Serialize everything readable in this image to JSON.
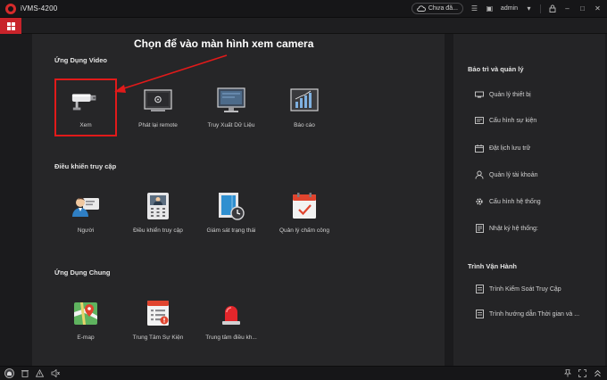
{
  "window": {
    "title": "iVMS-4200"
  },
  "titlebar": {
    "cloud_label": "Chưa đă...",
    "user": "admin"
  },
  "annotation": {
    "text": "Chọn để vào màn hình xem camera"
  },
  "sections": {
    "video": {
      "title": "Ứng Dụng Video",
      "tiles": [
        {
          "label": "Xem",
          "icon": "camera-icon"
        },
        {
          "label": "Phát lại remote",
          "icon": "playback-icon"
        },
        {
          "label": "Truy Xuất Dữ Liệu",
          "icon": "monitor-icon"
        },
        {
          "label": "Báo cáo",
          "icon": "report-chart-icon"
        }
      ]
    },
    "access": {
      "title": "Điều khiển truy cập",
      "tiles": [
        {
          "label": "Người",
          "icon": "person-card-icon"
        },
        {
          "label": "Điều khiển truy cập",
          "icon": "door-control-icon"
        },
        {
          "label": "Giám sát trạng thái",
          "icon": "status-monitor-icon"
        },
        {
          "label": "Quản lý chấm công",
          "icon": "calendar-check-icon"
        }
      ]
    },
    "common": {
      "title": "Ứng Dụng Chung",
      "tiles": [
        {
          "label": "E-map",
          "icon": "map-icon"
        },
        {
          "label": "Trung Tâm Sự Kiện",
          "icon": "event-list-icon"
        },
        {
          "label": "Trung tâm điều kh...",
          "icon": "alarm-light-icon"
        }
      ]
    }
  },
  "right_panel": {
    "maintenance": {
      "title": "Bảo trì và quản lý",
      "items": [
        {
          "label": "Quản lý thiết bị",
          "icon": "device-icon"
        },
        {
          "label": "Cấu hình sự kiện",
          "icon": "event-config-icon"
        },
        {
          "label": "Đặt lịch lưu trữ",
          "icon": "storage-schedule-icon"
        },
        {
          "label": "Quản lý tài khoản",
          "icon": "account-icon"
        },
        {
          "label": "Cấu hình hệ thống",
          "icon": "system-gear-icon"
        },
        {
          "label": "Nhật ký hệ thống:",
          "icon": "log-icon"
        }
      ]
    },
    "operation": {
      "title": "Trình Vận Hành",
      "items": [
        {
          "label": "Trình Kiểm Soát Truy Cập",
          "icon": "access-wizard-icon"
        },
        {
          "label": "Trình hướng dẫn Thời gian và ...",
          "icon": "time-wizard-icon"
        }
      ]
    }
  },
  "colors": {
    "accent": "#c8232a",
    "highlight": "#e11a1a",
    "background": "#262628"
  }
}
